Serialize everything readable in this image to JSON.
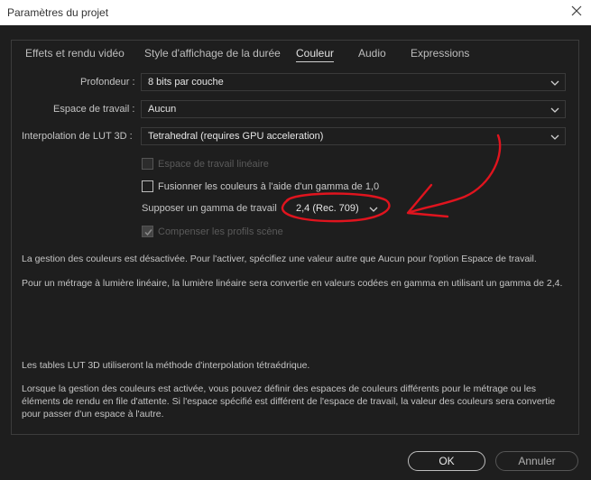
{
  "window": {
    "title": "Paramètres du projet"
  },
  "tabs": [
    {
      "label": "Effets et rendu vidéo",
      "active": false
    },
    {
      "label": "Style d'affichage de la durée",
      "active": false
    },
    {
      "label": "Couleur",
      "active": true
    },
    {
      "label": "Audio",
      "active": false
    },
    {
      "label": "Expressions",
      "active": false
    }
  ],
  "form": {
    "depth": {
      "label": "Profondeur :",
      "value": "8 bits par couche"
    },
    "workspace": {
      "label": "Espace de travail :",
      "value": "Aucun"
    },
    "lut": {
      "label": "Interpolation de LUT 3D :",
      "value": "Tetrahedral (requires GPU acceleration)"
    },
    "linear_checkbox": {
      "label": "Espace de travail linéaire",
      "checked": false,
      "enabled": false
    },
    "blend_checkbox": {
      "label": "Fusionner les couleurs à l'aide d'un gamma de 1,0",
      "checked": false,
      "enabled": true
    },
    "gamma": {
      "label": "Supposer un gamma de travail",
      "value": "2,4 (Rec. 709)"
    },
    "compensate_checkbox": {
      "label": "Compenser les profils scène",
      "checked": true,
      "enabled": false
    }
  },
  "info": {
    "line1": "La gestion des couleurs est désactivée. Pour l'activer, spécifiez une valeur autre que Aucun pour l'option Espace de travail.",
    "line2": "Pour un métrage à lumière linéaire, la lumière linéaire sera convertie en valeurs codées en gamma en utilisant un gamma de 2,4.",
    "line3": "Les tables LUT 3D utiliseront la méthode d'interpolation tétraédrique.",
    "line4a": "Lorsque la gestion des couleurs est activée, vous pouvez définir des espaces de couleurs différents pour le métrage ou les",
    "line4b": "éléments de rendu en file d'attente. Si l'espace spécifié est différent de l'espace de travail, la valeur des couleurs sera convertie",
    "line4c": "pour passer d'un espace à l'autre."
  },
  "buttons": {
    "ok": "OK",
    "cancel": "Annuler"
  },
  "colors": {
    "background": "#1e1e1e",
    "annotation": "#e0141e",
    "titlebar": "#ffffff"
  }
}
